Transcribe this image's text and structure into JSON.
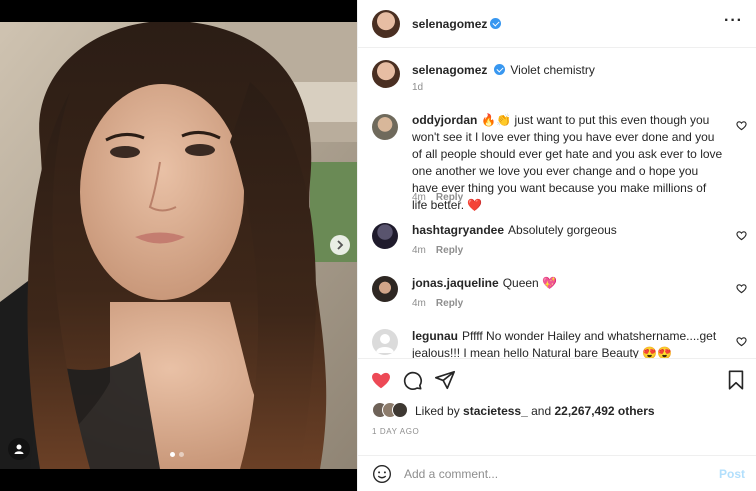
{
  "post": {
    "author": "selenagomez",
    "caption_text": "Violet chemistry",
    "caption_age": "1d"
  },
  "comments": [
    {
      "handle": "oddyjordan",
      "text": "🔥👏 just want to put this even though you won't see it I love ever thing you have ever done and you of all people should ever get hate and you ask ever to love one another we love you ever change and o hope you have ever thing you want because you make millions of life better. ❤️",
      "age": "4m",
      "reply": "Reply"
    },
    {
      "handle": "hashtagryandee",
      "text": "Absolutely gorgeous",
      "age": "4m",
      "reply": "Reply"
    },
    {
      "handle": "jonas.jaqueline",
      "text": "Queen 💖",
      "age": "4m",
      "reply": "Reply"
    },
    {
      "handle": "legunau",
      "text": "Pffff No wonder Hailey and whatshername....get jealous!!! I mean hello Natural bare Beauty 😍😍",
      "age": "",
      "reply": ""
    }
  ],
  "likes": {
    "prefix": "Liked by",
    "user": "stacietess_",
    "connector": "and",
    "others": "22,267,492 others"
  },
  "date": "1 DAY AGO",
  "add_comment": {
    "placeholder": "Add a comment...",
    "post_label": "Post"
  },
  "icons": {
    "more": "more-icon",
    "heart": "heart-icon",
    "comment": "comment-icon",
    "share": "share-icon",
    "save": "bookmark-icon",
    "emoji": "emoji-icon",
    "next": "chevron-right-icon",
    "tag": "user-tag-icon"
  },
  "colors": {
    "like_red": "#ed4956",
    "verified_blue": "#3897f0",
    "post_disabled": "#b2dffc",
    "muted": "#8e8e8e"
  }
}
